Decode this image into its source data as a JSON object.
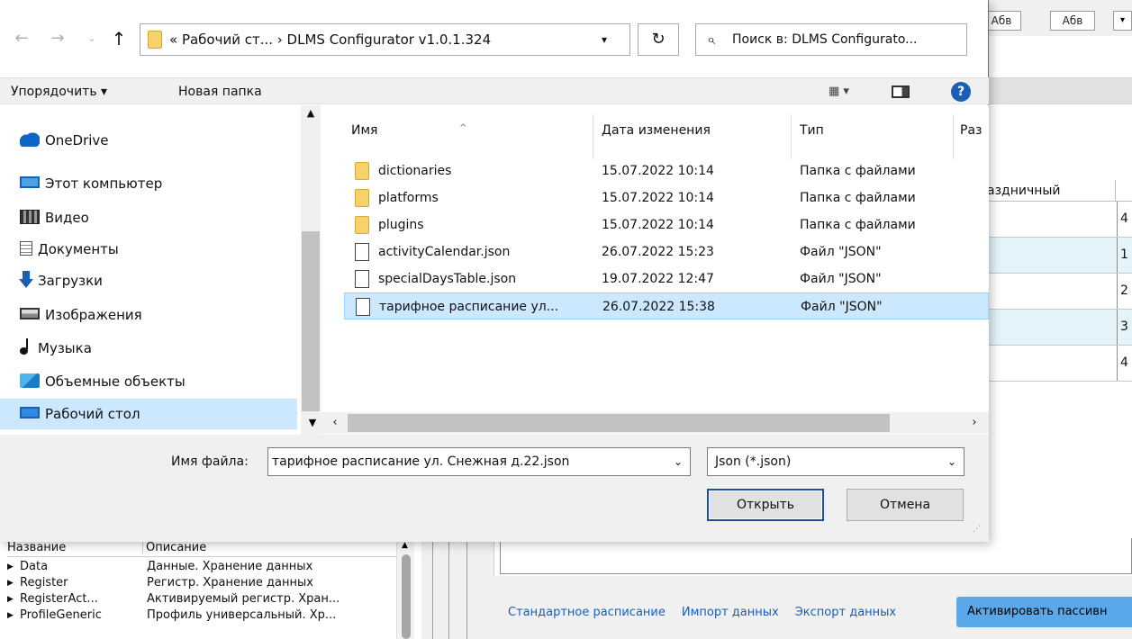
{
  "background": {
    "toolbar_buttons": [
      "Абв",
      "Абв"
    ],
    "toolbar_dropdown_icon": "chevron-down-icon",
    "table_header": "аздничный",
    "table_rows": [
      "4",
      "1",
      "2",
      "3",
      "4"
    ],
    "links": [
      "Стандартное расписание",
      "Импорт данных",
      "Экспорт данных"
    ],
    "activate_button": "Активировать пассивн",
    "object_list": {
      "columns": [
        "Название",
        "Описание"
      ],
      "rows": [
        {
          "name": "Data",
          "desc": "Данные. Хранение данных"
        },
        {
          "name": "Register",
          "desc": "Регистр. Хранение данных"
        },
        {
          "name": "RegisterAct...",
          "desc": "Активируемый регистр. Хран..."
        },
        {
          "name": "ProfileGeneric",
          "desc": "Профиль универсальный. Хр..."
        }
      ]
    }
  },
  "dialog": {
    "nav": {
      "back_icon": "back-arrow-icon",
      "forward_icon": "forward-arrow-icon",
      "recent_icon": "chevron-down-icon",
      "up_icon": "up-arrow-icon"
    },
    "address": {
      "path": "« Рабочий ст...  ›  DLMS Configurator v1.0.1.324",
      "dropdown": "▾",
      "refresh": "↻"
    },
    "search": {
      "icon": "⌕",
      "placeholder": "Поиск в: DLMS Configurato..."
    },
    "command_bar": {
      "organize": "Упорядочить ▾",
      "new_folder": "Новая папка",
      "view": "▦ ▾",
      "help": "?"
    },
    "nav_pane": {
      "items": [
        {
          "label": "OneDrive",
          "icon": "cloud-icon"
        },
        {
          "label": "Этот компьютер",
          "icon": "computer-icon"
        },
        {
          "label": "Видео",
          "icon": "video-icon"
        },
        {
          "label": "Документы",
          "icon": "documents-icon"
        },
        {
          "label": "Загрузки",
          "icon": "download-icon"
        },
        {
          "label": "Изображения",
          "icon": "pictures-icon"
        },
        {
          "label": "Музыка",
          "icon": "music-icon"
        },
        {
          "label": "Объемные объекты",
          "icon": "3d-objects-icon"
        },
        {
          "label": "Рабочий стол",
          "icon": "desktop-icon",
          "selected": true
        }
      ]
    },
    "columns": {
      "name": "Имя",
      "date": "Дата изменения",
      "type": "Тип",
      "size": "Раз"
    },
    "files": [
      {
        "name": "dictionaries",
        "date": "15.07.2022 10:14",
        "type": "Папка с файлами",
        "kind": "folder"
      },
      {
        "name": "platforms",
        "date": "15.07.2022 10:14",
        "type": "Папка с файлами",
        "kind": "folder"
      },
      {
        "name": "plugins",
        "date": "15.07.2022 10:14",
        "type": "Папка с файлами",
        "kind": "folder"
      },
      {
        "name": "activityCalendar.json",
        "date": "26.07.2022 15:23",
        "type": "Файл \"JSON\"",
        "kind": "file"
      },
      {
        "name": "specialDaysTable.json",
        "date": "19.07.2022 12:47",
        "type": "Файл \"JSON\"",
        "kind": "file"
      },
      {
        "name": "тарифное расписание ул...",
        "date": "26.07.2022 15:38",
        "type": "Файл \"JSON\"",
        "kind": "file",
        "selected": true
      }
    ],
    "footer": {
      "filename_label": "Имя файла:",
      "filename_value": "тарифное расписание ул. Снежная д.22.json",
      "filter_value": "Json (*.json)",
      "open_button": "Открыть",
      "cancel_button": "Отмена"
    }
  }
}
